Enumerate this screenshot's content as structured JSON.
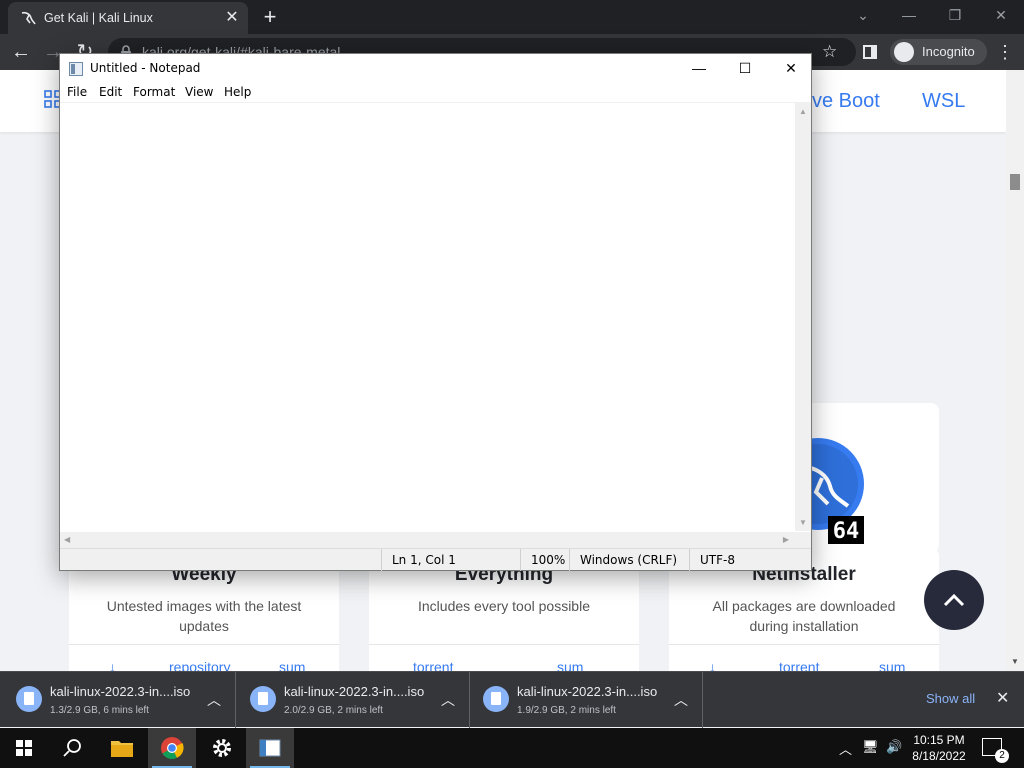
{
  "browser": {
    "tab_title": "Get Kali | Kali Linux",
    "url": "kali.org/get-kali/#kali-bare-metal",
    "incognito_label": "Incognito"
  },
  "site_nav": {
    "links": [
      "ve Boot",
      "WSL"
    ]
  },
  "cards": [
    {
      "heading": "Weekly",
      "description": "Untested images with the latest updates",
      "links": [
        "repository",
        "sum"
      ]
    },
    {
      "heading": "Everything",
      "description": "Includes every tool possible",
      "links": [
        "torrent",
        "sum"
      ]
    },
    {
      "heading": "NetInstaller",
      "description": "All packages are downloaded during installation",
      "links": [
        "torrent",
        "sum"
      ]
    }
  ],
  "badge_64": "64",
  "notepad": {
    "title": "Untitled - Notepad",
    "menu": [
      "File",
      "Edit",
      "Format",
      "View",
      "Help"
    ],
    "content": "",
    "status": {
      "position": "Ln 1, Col 1",
      "zoom": "100%",
      "line_ending": "Windows (CRLF)",
      "encoding": "UTF-8"
    }
  },
  "downloads": [
    {
      "name": "kali-linux-2022.3-in....iso",
      "status": "1.3/2.9 GB, 6 mins left"
    },
    {
      "name": "kali-linux-2022.3-in....iso",
      "status": "2.0/2.9 GB, 2 mins left"
    },
    {
      "name": "kali-linux-2022.3-in....iso",
      "status": "1.9/2.9 GB, 2 mins left"
    }
  ],
  "show_all_label": "Show all",
  "taskbar": {
    "time": "10:15 PM",
    "date": "8/18/2022",
    "notification_count": "2"
  }
}
